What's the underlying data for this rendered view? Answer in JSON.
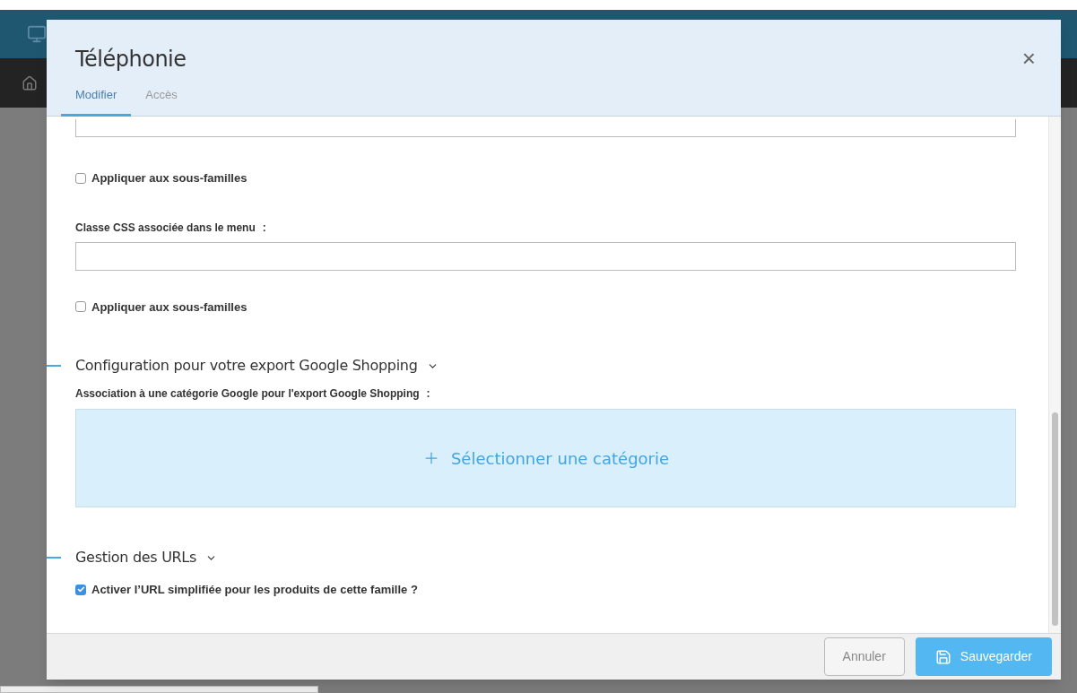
{
  "dialog": {
    "title": "Téléphonie",
    "close": "×",
    "tabs": [
      {
        "label": "Modifier",
        "selected": true
      },
      {
        "label": "Accès",
        "selected": false
      }
    ]
  },
  "form": [
    {
      "kind": "field"
    },
    {
      "kind": "checkbox",
      "label": "Appliquer aux sous-familles",
      "checked": false
    },
    {
      "kind": "labeled-field",
      "label": "Classe CSS associée dans le menu",
      "colon": ":"
    },
    {
      "kind": "checkbox",
      "label": "Appliquer aux sous-familles",
      "checked": false
    },
    {
      "kind": "section",
      "title": "Configuration pour votre export Google Shopping"
    },
    {
      "kind": "label",
      "label": "Association à une catégorie Google pour l'export Google Shopping",
      "colon": ":"
    },
    {
      "kind": "dropzone",
      "label": "Sélectionner une catégorie"
    },
    {
      "kind": "section",
      "title": "Gestion des URLs"
    },
    {
      "kind": "checkbox",
      "label": "Activer l’URL simplifiée pour les produits de cette famille ?",
      "checked": true
    }
  ],
  "footer": {
    "buttons": [
      {
        "label": "Annuler",
        "kind": "secondary"
      },
      {
        "label": "Sauvegarder",
        "kind": "primary"
      }
    ]
  }
}
